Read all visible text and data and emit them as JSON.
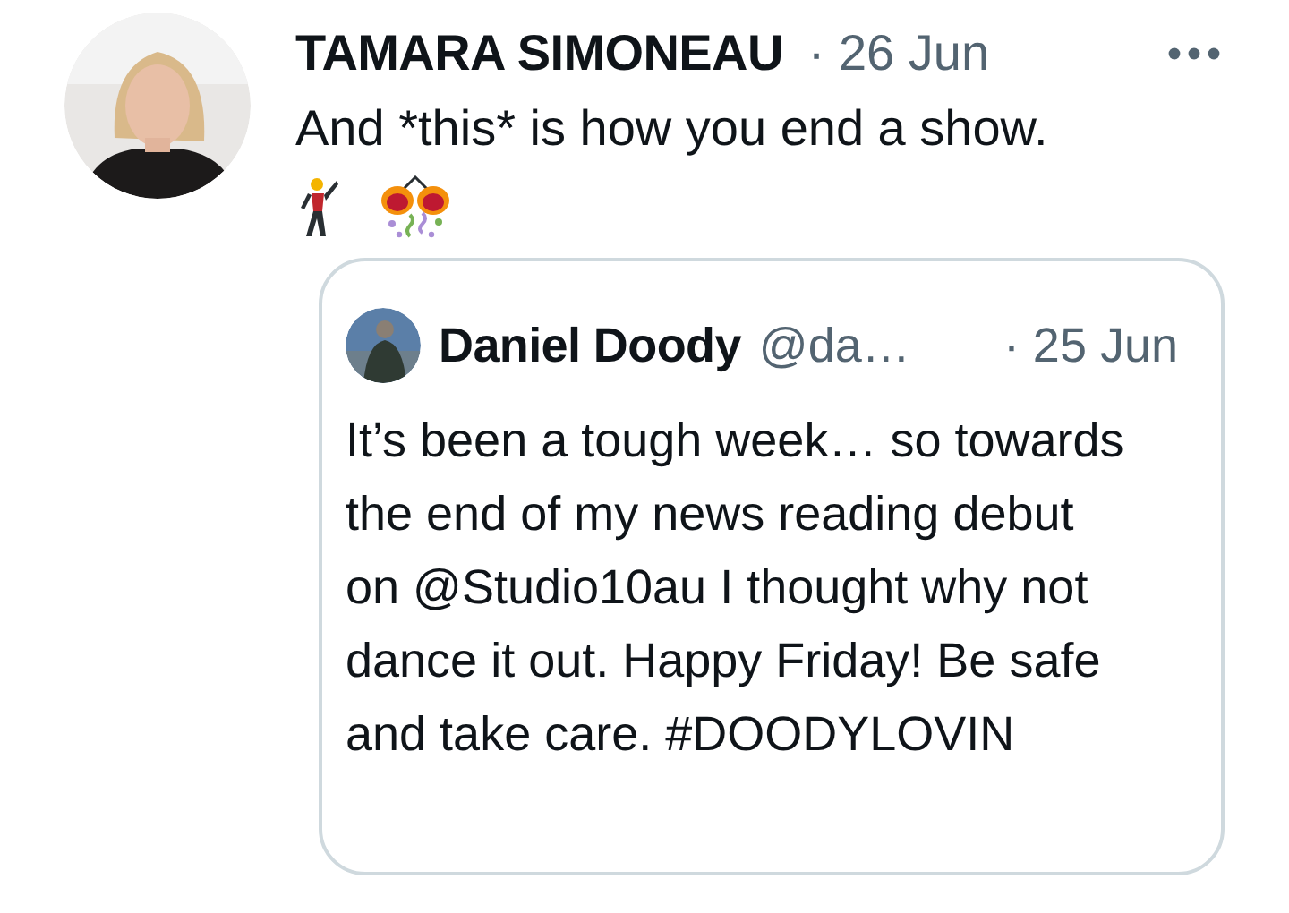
{
  "tweet": {
    "name": "TAMARA SIMONEAU",
    "time": "· 26 Jun",
    "text": "And *this* is how you end a show.",
    "quoted": {
      "name": "Daniel Doody",
      "handle": "@da…",
      "time": "· 25 Jun",
      "text": "It’s been a tough week… so towards the end of my news reading debut on @Studio10au I thought why not dance it out. Happy Friday! Be safe and take care. #DOODYLOVIN"
    }
  }
}
